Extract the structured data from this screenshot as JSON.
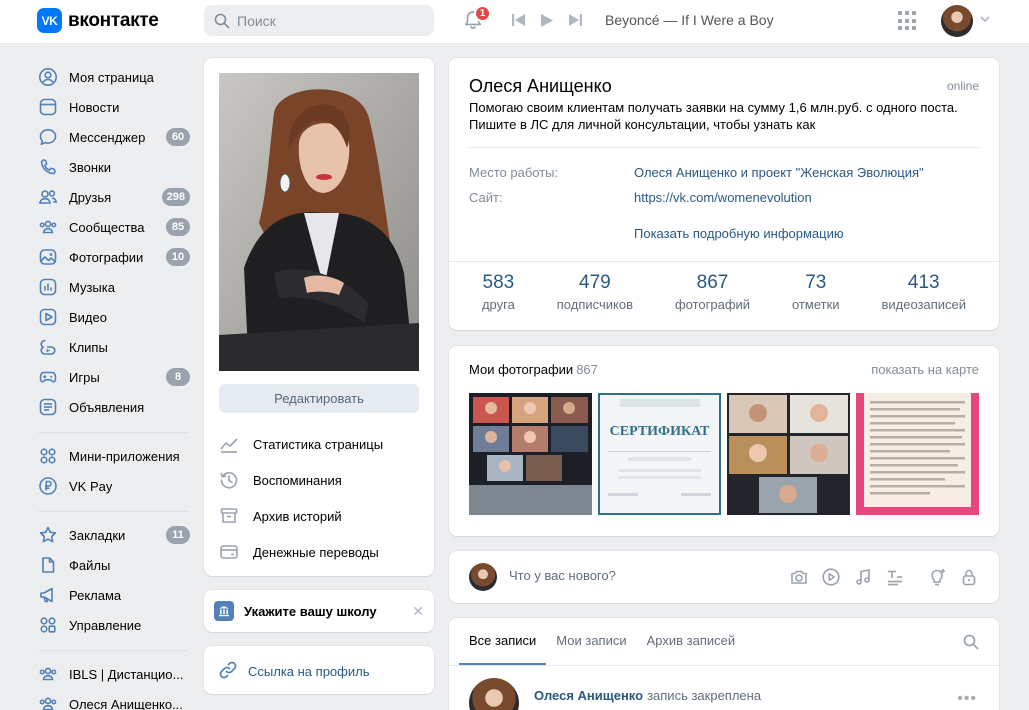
{
  "header": {
    "logo_mark": "VK",
    "logo_text": "вконтакте",
    "search_placeholder": "Поиск",
    "notifications_count": "1",
    "track": "Beyoncé — If I Were a Boy"
  },
  "nav": {
    "main": [
      {
        "label": "Моя страница",
        "icon": "user-circle-icon"
      },
      {
        "label": "Новости",
        "icon": "newspaper-icon"
      },
      {
        "label": "Мессенджер",
        "icon": "chat-bubble-icon",
        "count": "60"
      },
      {
        "label": "Звонки",
        "icon": "phone-icon"
      },
      {
        "label": "Друзья",
        "icon": "friends-icon",
        "count": "298"
      },
      {
        "label": "Сообщества",
        "icon": "communities-icon",
        "count": "85"
      },
      {
        "label": "Фотографии",
        "icon": "photo-icon",
        "count": "10"
      },
      {
        "label": "Музыка",
        "icon": "music-icon"
      },
      {
        "label": "Видео",
        "icon": "video-icon"
      },
      {
        "label": "Клипы",
        "icon": "clips-icon"
      },
      {
        "label": "Игры",
        "icon": "gamepad-icon",
        "count": "8"
      },
      {
        "label": "Объявления",
        "icon": "classifieds-icon"
      }
    ],
    "services": [
      {
        "label": "Мини-приложения",
        "icon": "mini-apps-icon"
      },
      {
        "label": "VK Pay",
        "icon": "vkpay-icon"
      }
    ],
    "tools": [
      {
        "label": "Закладки",
        "icon": "star-icon",
        "count": "11"
      },
      {
        "label": "Файлы",
        "icon": "file-icon"
      },
      {
        "label": "Реклама",
        "icon": "megaphone-icon"
      },
      {
        "label": "Управление",
        "icon": "manage-icon"
      }
    ],
    "groups": [
      {
        "label": "IBLS | Дистанцио...",
        "icon": "group-icon"
      },
      {
        "label": "Олеся Анищенко...",
        "icon": "group-icon"
      }
    ]
  },
  "profile_side": {
    "edit_label": "Редактировать",
    "links": [
      {
        "label": "Статистика страницы",
        "icon": "stats-icon"
      },
      {
        "label": "Воспоминания",
        "icon": "memories-icon"
      },
      {
        "label": "Архив историй",
        "icon": "archive-icon"
      },
      {
        "label": "Денежные переводы",
        "icon": "money-transfer-icon"
      }
    ],
    "school_label": "Укажите вашу школу",
    "profile_link_label": "Ссылка на профиль"
  },
  "profile": {
    "name": "Олеся Анищенко",
    "online": "online",
    "status": "Помогаю своим клиентам получать заявки на сумму 1,6 млн.руб. с одного поста. Пишите в ЛС для личной консультации, чтобы узнать как",
    "work_label": "Место работы:",
    "work_value": "Олеся Анищенко и проект \"Женская Эволюция\"",
    "site_label": "Сайт:",
    "site_value": "https://vk.com/womenevolution",
    "more_info": "Показать подробную информацию",
    "counters": [
      {
        "num": "583",
        "label": "друга"
      },
      {
        "num": "479",
        "label": "подписчиков"
      },
      {
        "num": "867",
        "label": "фотографий"
      },
      {
        "num": "73",
        "label": "отметки"
      },
      {
        "num": "413",
        "label": "видеозаписей"
      }
    ]
  },
  "photos": {
    "title": "Мои фотографии",
    "count": "867",
    "map_link": "показать на карте",
    "certificate_title": "СЕРТИФИКАТ"
  },
  "composer": {
    "placeholder": "Что у вас нового?"
  },
  "wall": {
    "tabs": [
      "Все записи",
      "Мои записи",
      "Архив записей"
    ],
    "author": "Олеся Анищенко",
    "pinned_note": "запись закреплена"
  },
  "colors": {
    "brand": "#0077ff",
    "link": "#2a5885",
    "badge": "#99a2ad",
    "notification": "#e64646",
    "page_bg": "#edeef0"
  }
}
